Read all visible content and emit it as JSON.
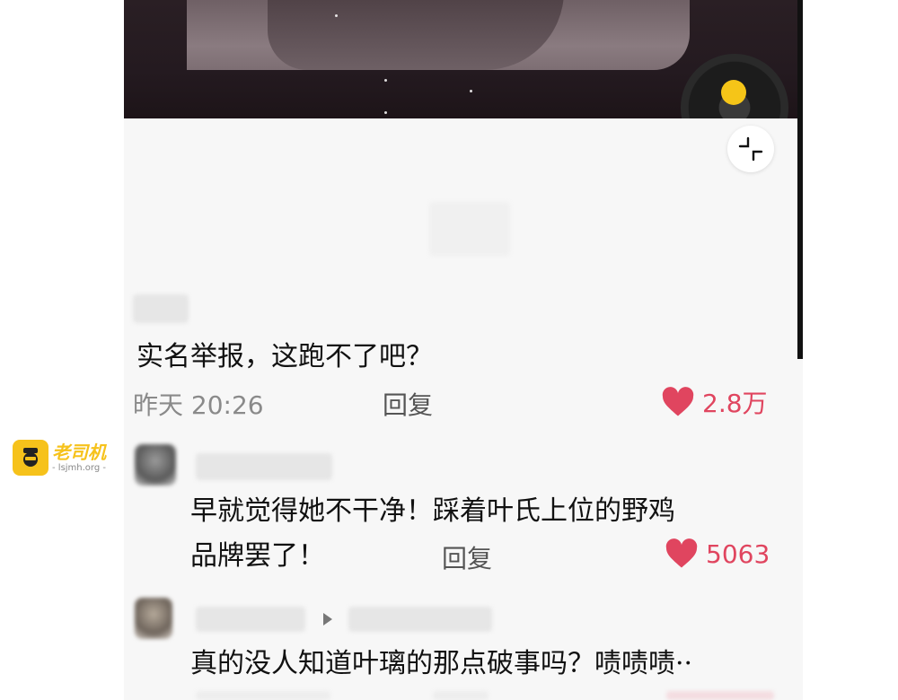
{
  "watermark": {
    "title": "老司机",
    "url": "- lsjmh.org -"
  },
  "video": {
    "player": "music-disc"
  },
  "comments": [
    {
      "text": "实名举报，这跑不了吧？",
      "time": "昨天 20:26",
      "reply_label": "回复",
      "likes": "2.8万"
    },
    {
      "text_line1": "早就觉得她不干净！踩着叶氏上位的野鸡",
      "text_line2": "品牌罢了！",
      "reply_label": "回复",
      "likes": "5063"
    },
    {
      "text": "真的没人知道叶璃的那点破事吗？啧啧啧··"
    }
  ],
  "colors": {
    "like": "#e0455f",
    "accent": "#f5c518"
  }
}
